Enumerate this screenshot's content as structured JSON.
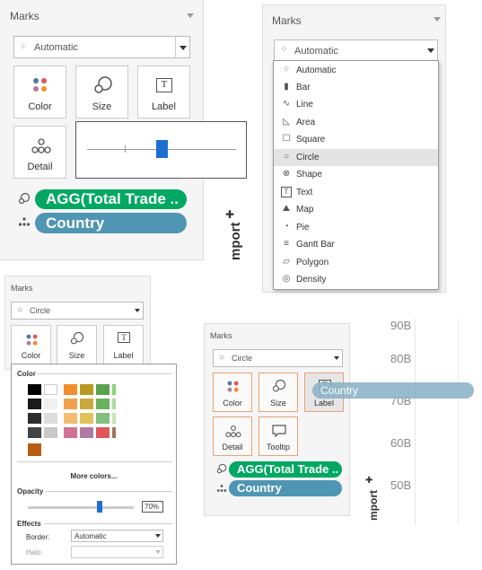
{
  "panel1": {
    "title": "Marks",
    "mark_type": "Automatic",
    "cards": [
      {
        "label": "Color",
        "icon": "color-dots-icon"
      },
      {
        "label": "Size",
        "icon": "size-icon"
      },
      {
        "label": "Label",
        "icon": "label-icon"
      },
      {
        "label": "Detail",
        "icon": "detail-icon"
      }
    ],
    "pills": [
      {
        "label": "AGG(Total Trade ..",
        "color": "#00a862"
      },
      {
        "label": "Country",
        "color": "#4e96b4"
      }
    ],
    "size_slider_value": 0.5,
    "import_label": "mport"
  },
  "panel2": {
    "title": "Marks",
    "mark_type": "Automatic",
    "menu": [
      {
        "label": "Automatic",
        "icon": "automatic-icon",
        "glyph": "⁘"
      },
      {
        "label": "Bar",
        "icon": "bar-icon",
        "glyph": "▮"
      },
      {
        "label": "Line",
        "icon": "line-icon",
        "glyph": "∿"
      },
      {
        "label": "Area",
        "icon": "area-icon",
        "glyph": "◺"
      },
      {
        "label": "Square",
        "icon": "square-icon",
        "glyph": "☐"
      },
      {
        "label": "Circle",
        "icon": "circle-icon",
        "glyph": "○"
      },
      {
        "label": "Shape",
        "icon": "shape-icon",
        "glyph": "⊗"
      },
      {
        "label": "Text",
        "icon": "text-icon",
        "glyph": "T"
      },
      {
        "label": "Map",
        "icon": "map-icon",
        "glyph": "⛰"
      },
      {
        "label": "Pie",
        "icon": "pie-icon",
        "glyph": "◔"
      },
      {
        "label": "Gantt Bar",
        "icon": "gantt-bar-icon",
        "glyph": "≡"
      },
      {
        "label": "Polygon",
        "icon": "polygon-icon",
        "glyph": "▱"
      },
      {
        "label": "Density",
        "icon": "density-icon",
        "glyph": "◎"
      }
    ],
    "selected": "Circle"
  },
  "panel3": {
    "title": "Marks",
    "mark_type": "Circle",
    "cards": [
      {
        "label": "Color"
      },
      {
        "label": "Size"
      },
      {
        "label": "Label"
      }
    ],
    "color_popup": {
      "color_heading": "Color",
      "more_colors": "More colors...",
      "opacity_heading": "Opacity",
      "opacity_value": "70%",
      "opacity_fraction": 0.7,
      "effects_heading": "Effects",
      "border_label": "Border:",
      "border_value": "Automatic",
      "halo_label": "Halo:",
      "halo_value": "",
      "swatches": [
        [
          "#000000",
          "#ffffff",
          "#f28e2b",
          "#b79a20",
          "#59a14f",
          "#8cd17d"
        ],
        [
          "#1a1a1a",
          "#f0f0f0",
          "#f1a04d",
          "#c9aa3c",
          "#6bb25e",
          "#a9dc9c"
        ],
        [
          "#2d2d2d",
          "#dcdcdc",
          "#f5bd6f",
          "#e1c35a",
          "#80c07a",
          "#c3e6b4"
        ],
        [
          "#444444",
          "#c8c8c8",
          "#d37295",
          "#b07aa1",
          "#e15759",
          "#9d7660"
        ],
        [
          "#b85c14"
        ]
      ]
    }
  },
  "panel4": {
    "title": "Marks",
    "mark_type": "Circle",
    "cards": [
      {
        "label": "Color"
      },
      {
        "label": "Size"
      },
      {
        "label": "Label"
      },
      {
        "label": "Detail"
      },
      {
        "label": "Tooltip"
      }
    ],
    "pills": [
      {
        "label": "AGG(Total Trade ..",
        "color": "#00a862"
      },
      {
        "label": "Country",
        "color": "#4e96b4"
      }
    ],
    "drag_pill": "Country",
    "import_label": "mport",
    "axis_ticks": [
      "90B",
      "80B",
      "70B",
      "60B",
      "50B"
    ]
  }
}
